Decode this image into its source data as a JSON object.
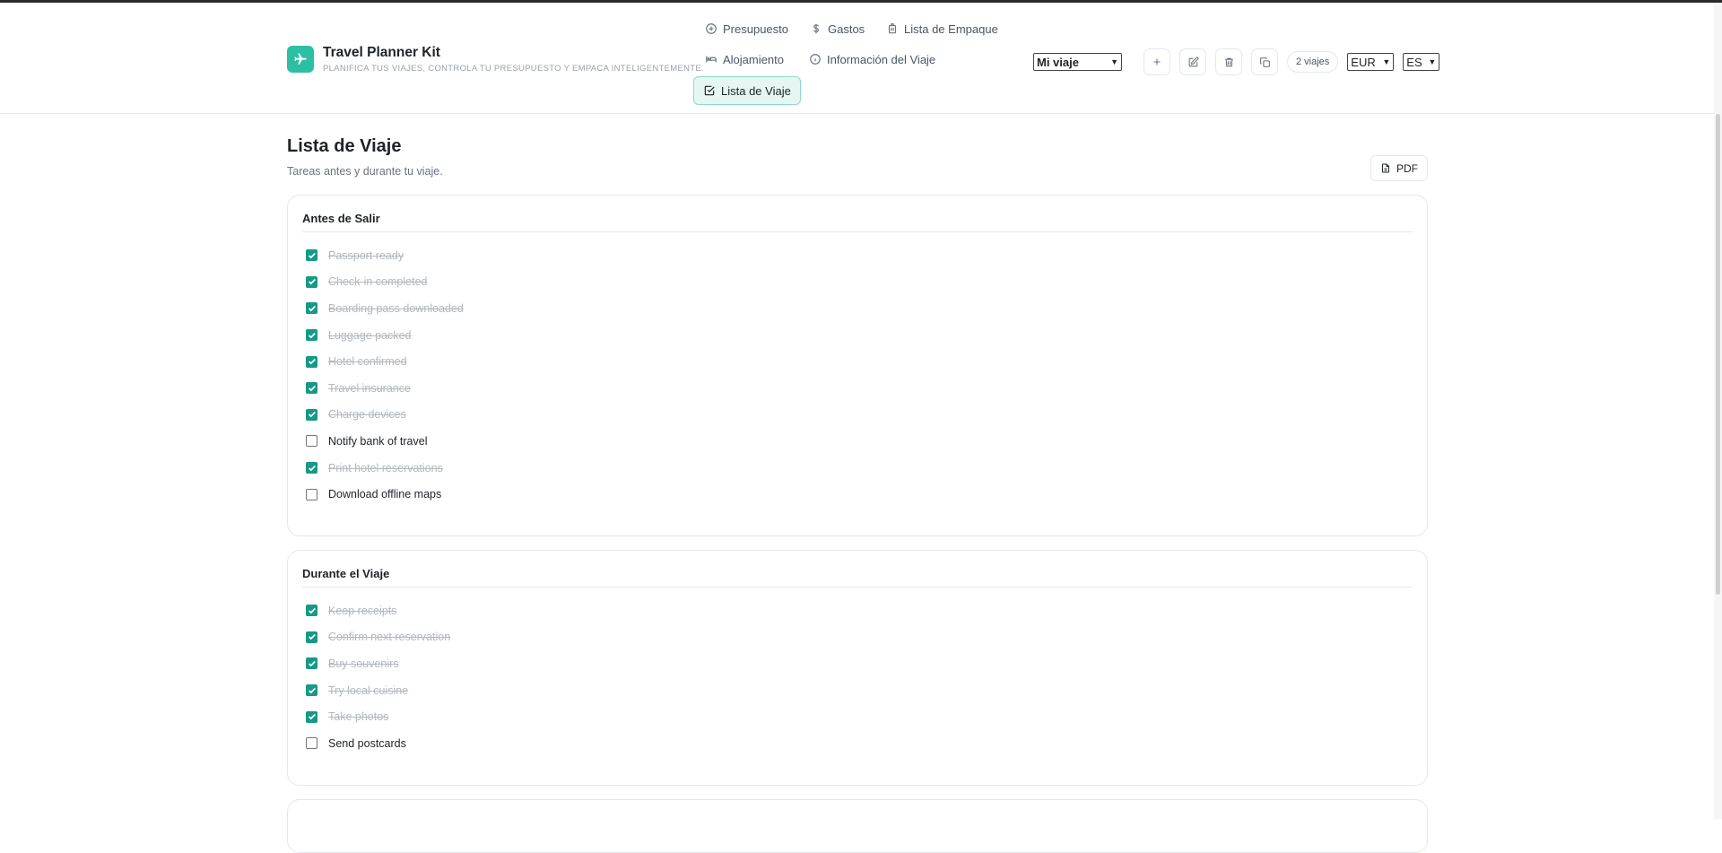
{
  "app": {
    "name": "Travel Planner Kit",
    "tagline": "PLANIFICA TUS VIAJES, CONTROLA TU PRESUPUESTO Y EMPACA INTELIGENTEMENTE."
  },
  "nav": {
    "presupuesto": "Presupuesto",
    "gastos": "Gastos",
    "empaque": "Lista de Empaque",
    "alojamiento": "Alojamiento",
    "informacion": "Información del Viaje",
    "viaje": "Lista de Viaje",
    "active": "Lista de Viaje"
  },
  "toolbar": {
    "trip_select": "Mi viaje",
    "trip_count": "2 viajes",
    "currency": "EUR",
    "language": "ES",
    "icons": [
      "plus-icon",
      "edit-icon",
      "trash-icon",
      "copy-icon"
    ]
  },
  "page": {
    "title": "Lista de Viaje",
    "subtitle": "Tareas antes y durante tu viaje.",
    "pdf_label": "PDF"
  },
  "sections": [
    {
      "title": "Antes de Salir",
      "items": [
        {
          "label": "Passport ready",
          "done": true
        },
        {
          "label": "Check-in completed",
          "done": true
        },
        {
          "label": "Boarding pass downloaded",
          "done": true
        },
        {
          "label": "Luggage packed",
          "done": true
        },
        {
          "label": "Hotel confirmed",
          "done": true
        },
        {
          "label": "Travel insurance",
          "done": true
        },
        {
          "label": "Charge devices",
          "done": true
        },
        {
          "label": "Notify bank of travel",
          "done": false
        },
        {
          "label": "Print hotel reservations",
          "done": true
        },
        {
          "label": "Download offline maps",
          "done": false
        }
      ]
    },
    {
      "title": "Durante el Viaje",
      "items": [
        {
          "label": "Keep receipts",
          "done": true
        },
        {
          "label": "Confirm next reservation",
          "done": true
        },
        {
          "label": "Buy souvenirs",
          "done": true
        },
        {
          "label": "Try local cuisine",
          "done": true
        },
        {
          "label": "Take photos",
          "done": true
        },
        {
          "label": "Send postcards",
          "done": false
        }
      ]
    }
  ],
  "colors": {
    "accent": "#2bbfa4",
    "checkbox_checked": "#159a87",
    "active_tab_bg": "#e6f6f3",
    "done_text": "#b3b8bf"
  }
}
